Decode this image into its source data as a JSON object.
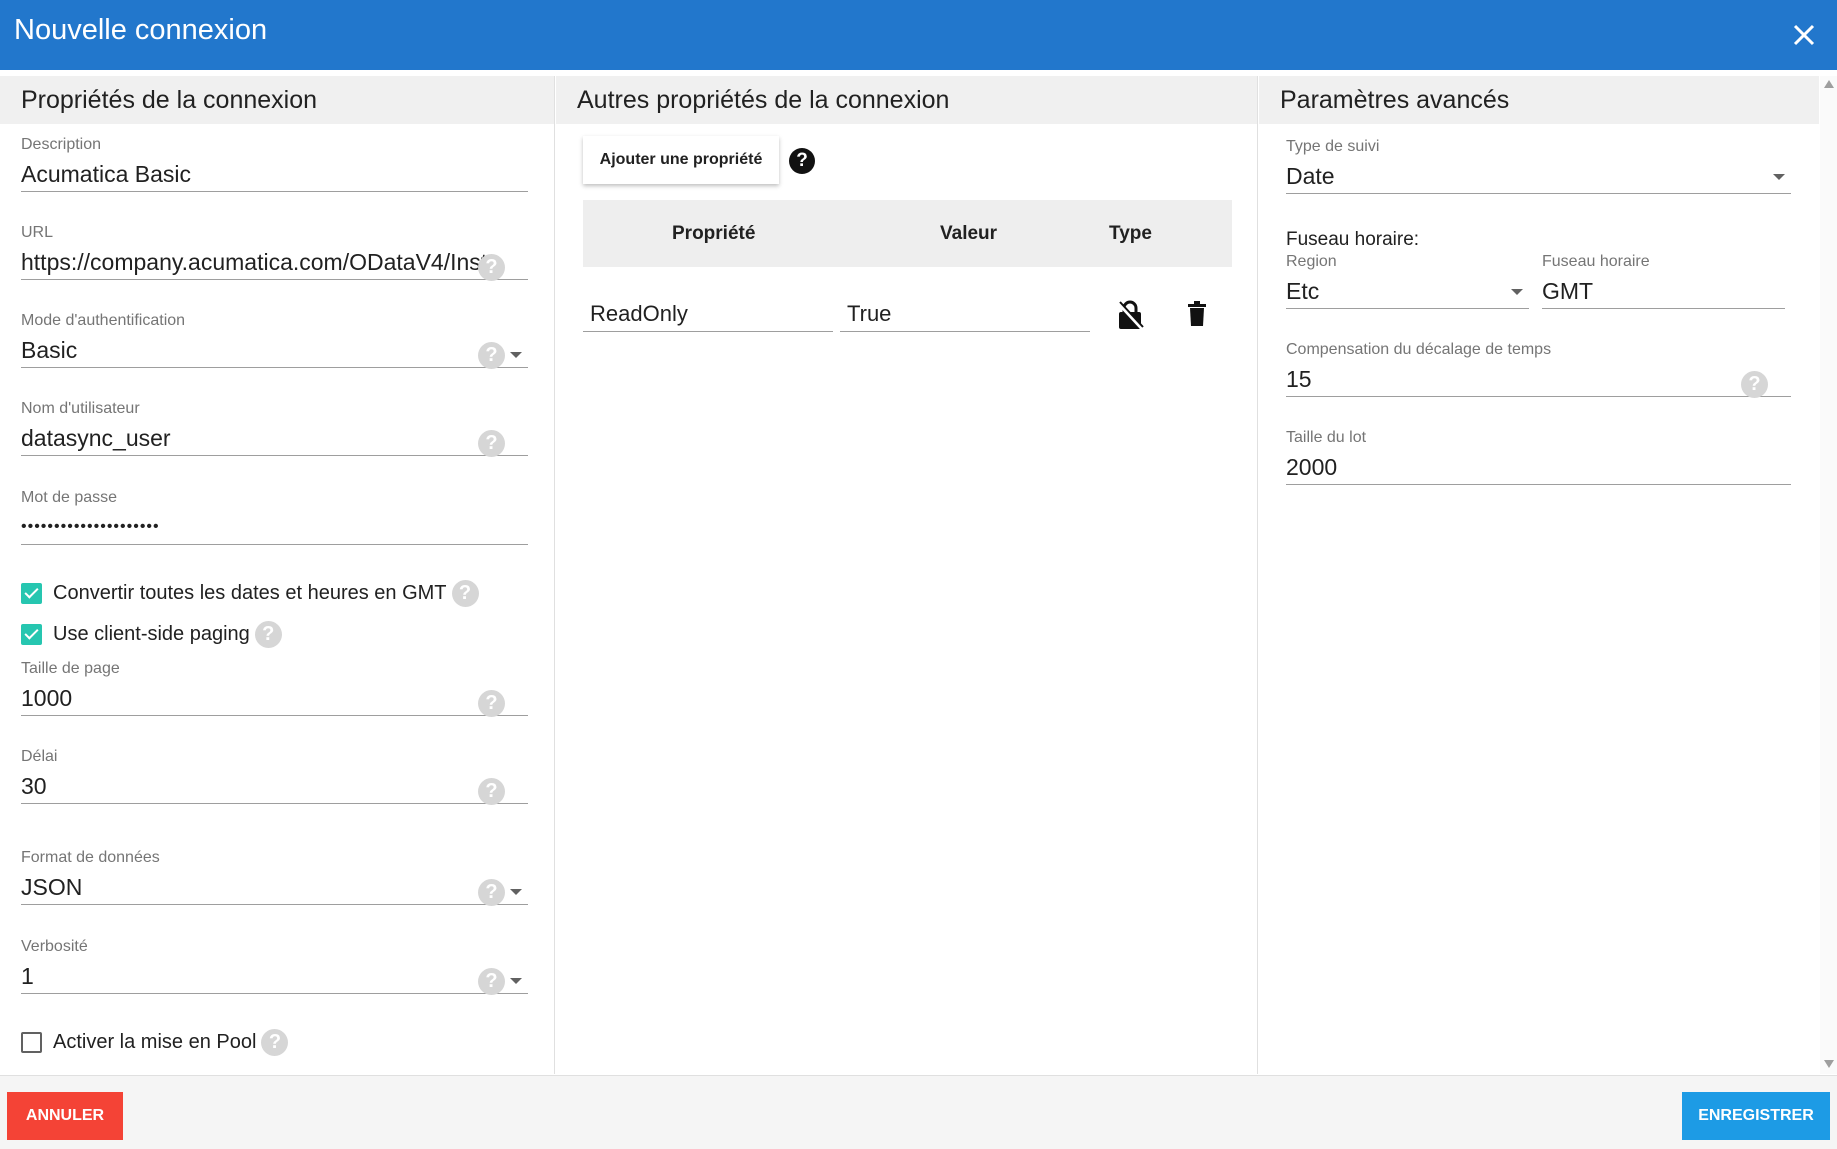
{
  "dialog": {
    "title": "Nouvelle connexion"
  },
  "col1": {
    "heading": "Propriétés de la connexion",
    "description": {
      "label": "Description",
      "value": "Acumatica Basic"
    },
    "url": {
      "label": "URL",
      "value": "https://company.acumatica.com/ODataV4/Inst"
    },
    "auth_mode": {
      "label": "Mode d'authentification",
      "value": "Basic"
    },
    "username": {
      "label": "Nom d'utilisateur",
      "value": "datasync_user"
    },
    "password": {
      "label": "Mot de passe",
      "value": "•••••••••••••••••••••"
    },
    "convert_gmt": {
      "label": "Convertir toutes les dates et heures en GMT",
      "checked": true
    },
    "client_paging": {
      "label": "Use client-side paging",
      "checked": true
    },
    "page_size": {
      "label": "Taille de page",
      "value": "1000"
    },
    "delay": {
      "label": "Délai",
      "value": "30"
    },
    "data_format": {
      "label": "Format de données",
      "value": "JSON"
    },
    "verbosity": {
      "label": "Verbosité",
      "value": "1"
    },
    "pooling": {
      "label": "Activer la mise en Pool",
      "checked": false
    }
  },
  "col2": {
    "heading": "Autres propriétés de la connexion",
    "add_button": "Ajouter une propriété",
    "table": {
      "headers": [
        "Propriété",
        "Valeur",
        "Type"
      ],
      "rows": [
        {
          "property": "ReadOnly",
          "value": "True",
          "type_icon": "lock-icon",
          "delete_icon": "trash-icon"
        }
      ]
    }
  },
  "col3": {
    "heading": "Paramètres avancés",
    "tracking_type": {
      "label": "Type de suivi",
      "value": "Date"
    },
    "timezone_label": "Fuseau horaire:",
    "region": {
      "label": "Region",
      "value": "Etc"
    },
    "timezone": {
      "label": "Fuseau horaire",
      "value": "GMT"
    },
    "time_offset": {
      "label": "Compensation du décalage de temps",
      "value": "15"
    },
    "batch_size": {
      "label": "Taille du lot",
      "value": "2000"
    }
  },
  "footer": {
    "cancel": "ANNULER",
    "save": "ENREGISTRER"
  },
  "colors": {
    "header": "#2277cc",
    "checkbox": "#26c6b0",
    "cancel": "#f44336",
    "save": "#1d9be5"
  }
}
